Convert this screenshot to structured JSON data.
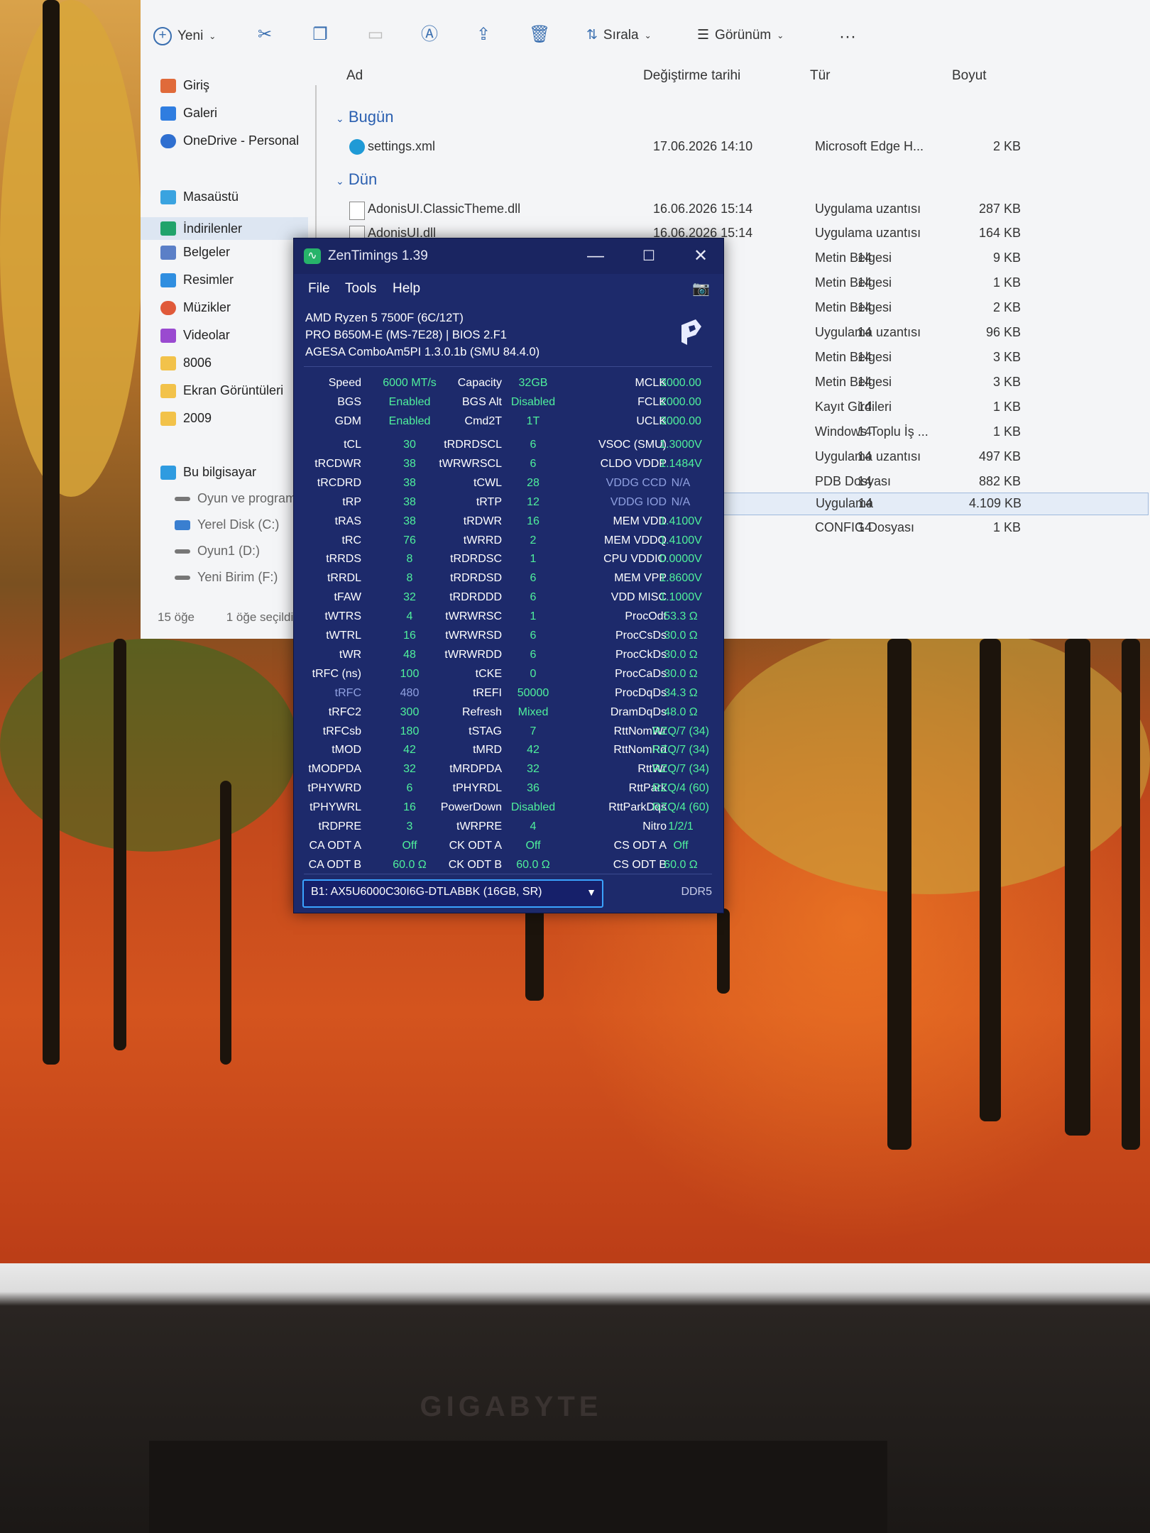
{
  "explorer": {
    "toolbar": {
      "new_label": "Yeni",
      "sort_label": "Sırala",
      "view_label": "Görünüm",
      "more_label": "···"
    },
    "nav": {
      "home": "Giriş",
      "gallery": "Galeri",
      "onedrive": "OneDrive - Personal",
      "desktop": "Masaüstü",
      "downloads": "İndirilenler",
      "documents": "Belgeler",
      "pictures": "Resimler",
      "music": "Müzikler",
      "videos": "Videolar",
      "folder1": "8006",
      "folder2": "Ekran Görüntüleri",
      "folder3": "2009",
      "this_pc": "Bu bilgisayar",
      "drive_games": "Oyun ve program",
      "drive_c": "Yerel Disk (C:)",
      "drive_d": "Oyun1 (D:)",
      "drive_f": "Yeni Birim (F:)"
    },
    "columns": {
      "name": "Ad",
      "date": "Değiştirme tarihi",
      "type": "Tür",
      "size": "Boyut"
    },
    "groups": {
      "today": "Bugün",
      "yesterday": "Dün"
    },
    "rows": [
      {
        "name": "settings.xml",
        "date": "17.06.2026 14:10",
        "type": "Microsoft Edge H...",
        "size": "2 KB"
      },
      {
        "name": "AdonisUI.ClassicTheme.dll",
        "date": "16.06.2026 15:14",
        "type": "Uygulama uzantısı",
        "size": "287 KB"
      },
      {
        "name": "AdonisUI.dll",
        "date": "16.06.2026 15:14",
        "type": "Uygulama uzantısı",
        "size": "164 KB"
      },
      {
        "name": "",
        "date": "14",
        "type": "Metin Belgesi",
        "size": "9 KB"
      },
      {
        "name": "",
        "date": "14",
        "type": "Metin Belgesi",
        "size": "1 KB"
      },
      {
        "name": "",
        "date": "14",
        "type": "Metin Belgesi",
        "size": "2 KB"
      },
      {
        "name": "",
        "date": "14",
        "type": "Uygulama uzantısı",
        "size": "96 KB"
      },
      {
        "name": "",
        "date": "14",
        "type": "Metin Belgesi",
        "size": "3 KB"
      },
      {
        "name": "",
        "date": "14",
        "type": "Metin Belgesi",
        "size": "3 KB"
      },
      {
        "name": "",
        "date": "14",
        "type": "Kayıt Girdileri",
        "size": "1 KB"
      },
      {
        "name": "",
        "date": "14",
        "type": "Windows Toplu İş ...",
        "size": "1 KB"
      },
      {
        "name": "",
        "date": "14",
        "type": "Uygulama uzantısı",
        "size": "497 KB"
      },
      {
        "name": "",
        "date": "14",
        "type": "PDB Dosyası",
        "size": "882 KB"
      },
      {
        "name": "",
        "date": "14",
        "type": "Uygulama",
        "size": "4.109 KB"
      },
      {
        "name": "",
        "date": "14",
        "type": "CONFIG Dosyası",
        "size": "1 KB"
      }
    ],
    "status": {
      "count": "15 öğe",
      "selected": "1 öğe seçildi"
    }
  },
  "zen": {
    "title": "ZenTimings 1.39",
    "menu": {
      "file": "File",
      "tools": "Tools",
      "help": "Help"
    },
    "info": {
      "cpu": "AMD Ryzen 5 7500F (6C/12T)",
      "board": "PRO B650M-E (MS-7E28) | BIOS 2.F1",
      "agesa": "AGESA ComboAm5PI 1.3.0.1b (SMU 84.4.0)"
    },
    "top": [
      [
        "Speed",
        "6000 MT/s",
        "Capacity",
        "32GB",
        "MCLK",
        "3000.00"
      ],
      [
        "BGS",
        "Enabled",
        "BGS Alt",
        "Disabled",
        "FCLK",
        "2000.00"
      ],
      [
        "GDM",
        "Enabled",
        "Cmd2T",
        "1T",
        "UCLK",
        "3000.00"
      ]
    ],
    "rows": [
      [
        "tCL",
        "30",
        "tRDRDSCL",
        "6",
        "VSOC (SMU)",
        "1.3000V"
      ],
      [
        "tRCDWR",
        "38",
        "tWRWRSCL",
        "6",
        "CLDO VDDP",
        "1.1484V"
      ],
      [
        "tRCDRD",
        "38",
        "tCWL",
        "28",
        "VDDG CCD",
        "N/A"
      ],
      [
        "tRP",
        "38",
        "tRTP",
        "12",
        "VDDG IOD",
        "N/A"
      ],
      [
        "tRAS",
        "38",
        "tRDWR",
        "16",
        "MEM VDD",
        "1.4100V"
      ],
      [
        "tRC",
        "76",
        "tWRRD",
        "2",
        "MEM VDDQ",
        "1.4100V"
      ],
      [
        "tRRDS",
        "8",
        "tRDRDSC",
        "1",
        "CPU VDDIO",
        "0.0000V"
      ],
      [
        "tRRDL",
        "8",
        "tRDRDSD",
        "6",
        "MEM VPP",
        "1.8600V"
      ],
      [
        "tFAW",
        "32",
        "tRDRDDD",
        "6",
        "VDD MISC",
        "1.1000V"
      ],
      [
        "tWTRS",
        "4",
        "tWRWRSC",
        "1",
        "ProcOdt",
        "53.3 Ω"
      ],
      [
        "tWTRL",
        "16",
        "tWRWRSD",
        "6",
        "ProcCsDs",
        "30.0 Ω"
      ],
      [
        "tWR",
        "48",
        "tWRWRDD",
        "6",
        "ProcCkDs",
        "30.0 Ω"
      ],
      [
        "tRFC (ns)",
        "100",
        "tCKE",
        "0",
        "ProcCaDs",
        "30.0 Ω"
      ],
      [
        "tRFC",
        "480",
        "tREFI",
        "50000",
        "ProcDqDs",
        "34.3 Ω"
      ],
      [
        "tRFC2",
        "300",
        "Refresh",
        "Mixed",
        "DramDqDs",
        "48.0 Ω"
      ],
      [
        "tRFCsb",
        "180",
        "tSTAG",
        "7",
        "RttNomWr",
        "RZQ/7 (34)"
      ],
      [
        "tMOD",
        "42",
        "tMRD",
        "42",
        "RttNomRd",
        "RZQ/7 (34)"
      ],
      [
        "tMODPDA",
        "32",
        "tMRDPDA",
        "32",
        "RttWr",
        "RZQ/7 (34)"
      ],
      [
        "tPHYWRD",
        "6",
        "tPHYRDL",
        "36",
        "RttPark",
        "RZQ/4 (60)"
      ],
      [
        "tPHYWRL",
        "16",
        "PowerDown",
        "Disabled",
        "RttParkDqs",
        "RZQ/4 (60)"
      ],
      [
        "tRDPRE",
        "3",
        "tWRPRE",
        "4",
        "Nitro",
        "1/2/1"
      ],
      [
        "CA ODT A",
        "Off",
        "CK ODT A",
        "Off",
        "CS ODT A",
        "Off"
      ],
      [
        "CA ODT B",
        "60.0 Ω",
        "CK ODT B",
        "60.0 Ω",
        "CS ODT B",
        "60.0 Ω"
      ]
    ],
    "module": "B1: AX5U6000C30I6G-DTLABBK (16GB, SR)",
    "memtype": "DDR5",
    "value_color": "#4ff09c",
    "dim_color": "#8fa0e0"
  },
  "monitor": {
    "brand": "GIGABYTE"
  }
}
